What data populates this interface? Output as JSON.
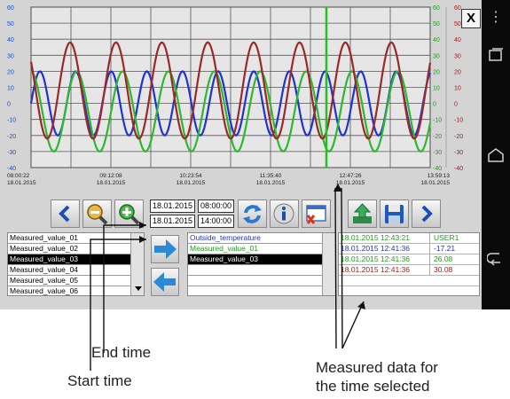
{
  "chart_data": {
    "type": "line",
    "x_ticks": [
      {
        "time": "08:00:22",
        "date": "18.01.2015"
      },
      {
        "time": "09:12:08",
        "date": "18.01.2015"
      },
      {
        "time": "10:23:54",
        "date": "18.01.2015"
      },
      {
        "time": "11:35:40",
        "date": "18.01.2015"
      },
      {
        "time": "12:47:26",
        "date": "18.01.2015"
      },
      {
        "time": "13:59:13",
        "date": "18.01.2015"
      }
    ],
    "left_axis": {
      "ticks": [
        60,
        50,
        40,
        30,
        20,
        10,
        0,
        -10,
        -20,
        -30,
        -40
      ],
      "ylim": [
        -40,
        60
      ],
      "color": "#1a4fd0"
    },
    "right_axis_1": {
      "ticks": [
        60,
        50,
        40,
        30,
        20,
        10,
        0,
        -10,
        -20,
        -30,
        -40
      ],
      "ylim": [
        -40,
        60
      ],
      "color": "#1da01d"
    },
    "right_axis_2": {
      "ticks": [
        60,
        50,
        40,
        30,
        20,
        10,
        0,
        -10,
        -20,
        -30,
        -40
      ],
      "ylim": [
        -40,
        60
      ],
      "color": "#a02020"
    },
    "cursor_fraction": 0.74,
    "series": [
      {
        "color": "#2233cc",
        "mean": 0,
        "amplitude": 20,
        "cycles": 11.2,
        "phase": 0.0
      },
      {
        "color": "#2fb82f",
        "mean": -5,
        "amplitude": 25,
        "cycles": 8.7,
        "phase": 1.6
      },
      {
        "color": "#9a2a2a",
        "mean": 8,
        "amplitude": 30,
        "cycles": 8.7,
        "phase": 2.5
      }
    ],
    "grid": true
  },
  "toolbar": {
    "start_date": "18.01.2015",
    "start_time": "08:00:00",
    "end_date": "18.01.2015",
    "end_time": "14:00:00"
  },
  "close_label": "X",
  "available_values": [
    "Measured_value_01",
    "Measured_value_02",
    "Measured_value_03",
    "Measured_value_04",
    "Measured_value_05",
    "Measured_value_06"
  ],
  "available_selected_index": 2,
  "selected_values": [
    {
      "label": "Outside_temperature",
      "color": "#2233cc"
    },
    {
      "label": "Measured_value_01",
      "color": "#1da01d"
    },
    {
      "label": "Measured_value_03",
      "color": "#ffffff"
    }
  ],
  "measured_rows": [
    {
      "timestamp": "18.01.2015 12:43:21",
      "value": "USER1",
      "color": "#1da01d"
    },
    {
      "timestamp": "18.01.2015 12:41:36",
      "value": "-17.21",
      "color": "#2233cc"
    },
    {
      "timestamp": "18.01.2015 12:41:36",
      "value": "26.08",
      "color": "#1da01d"
    },
    {
      "timestamp": "18.01.2015 12:41:36",
      "value": "30.08",
      "color": "#a02020"
    }
  ],
  "annotations": {
    "end_time": "End time",
    "start_time": "Start time",
    "measured_line1": "Measured data for",
    "measured_line2": "the time selected"
  }
}
